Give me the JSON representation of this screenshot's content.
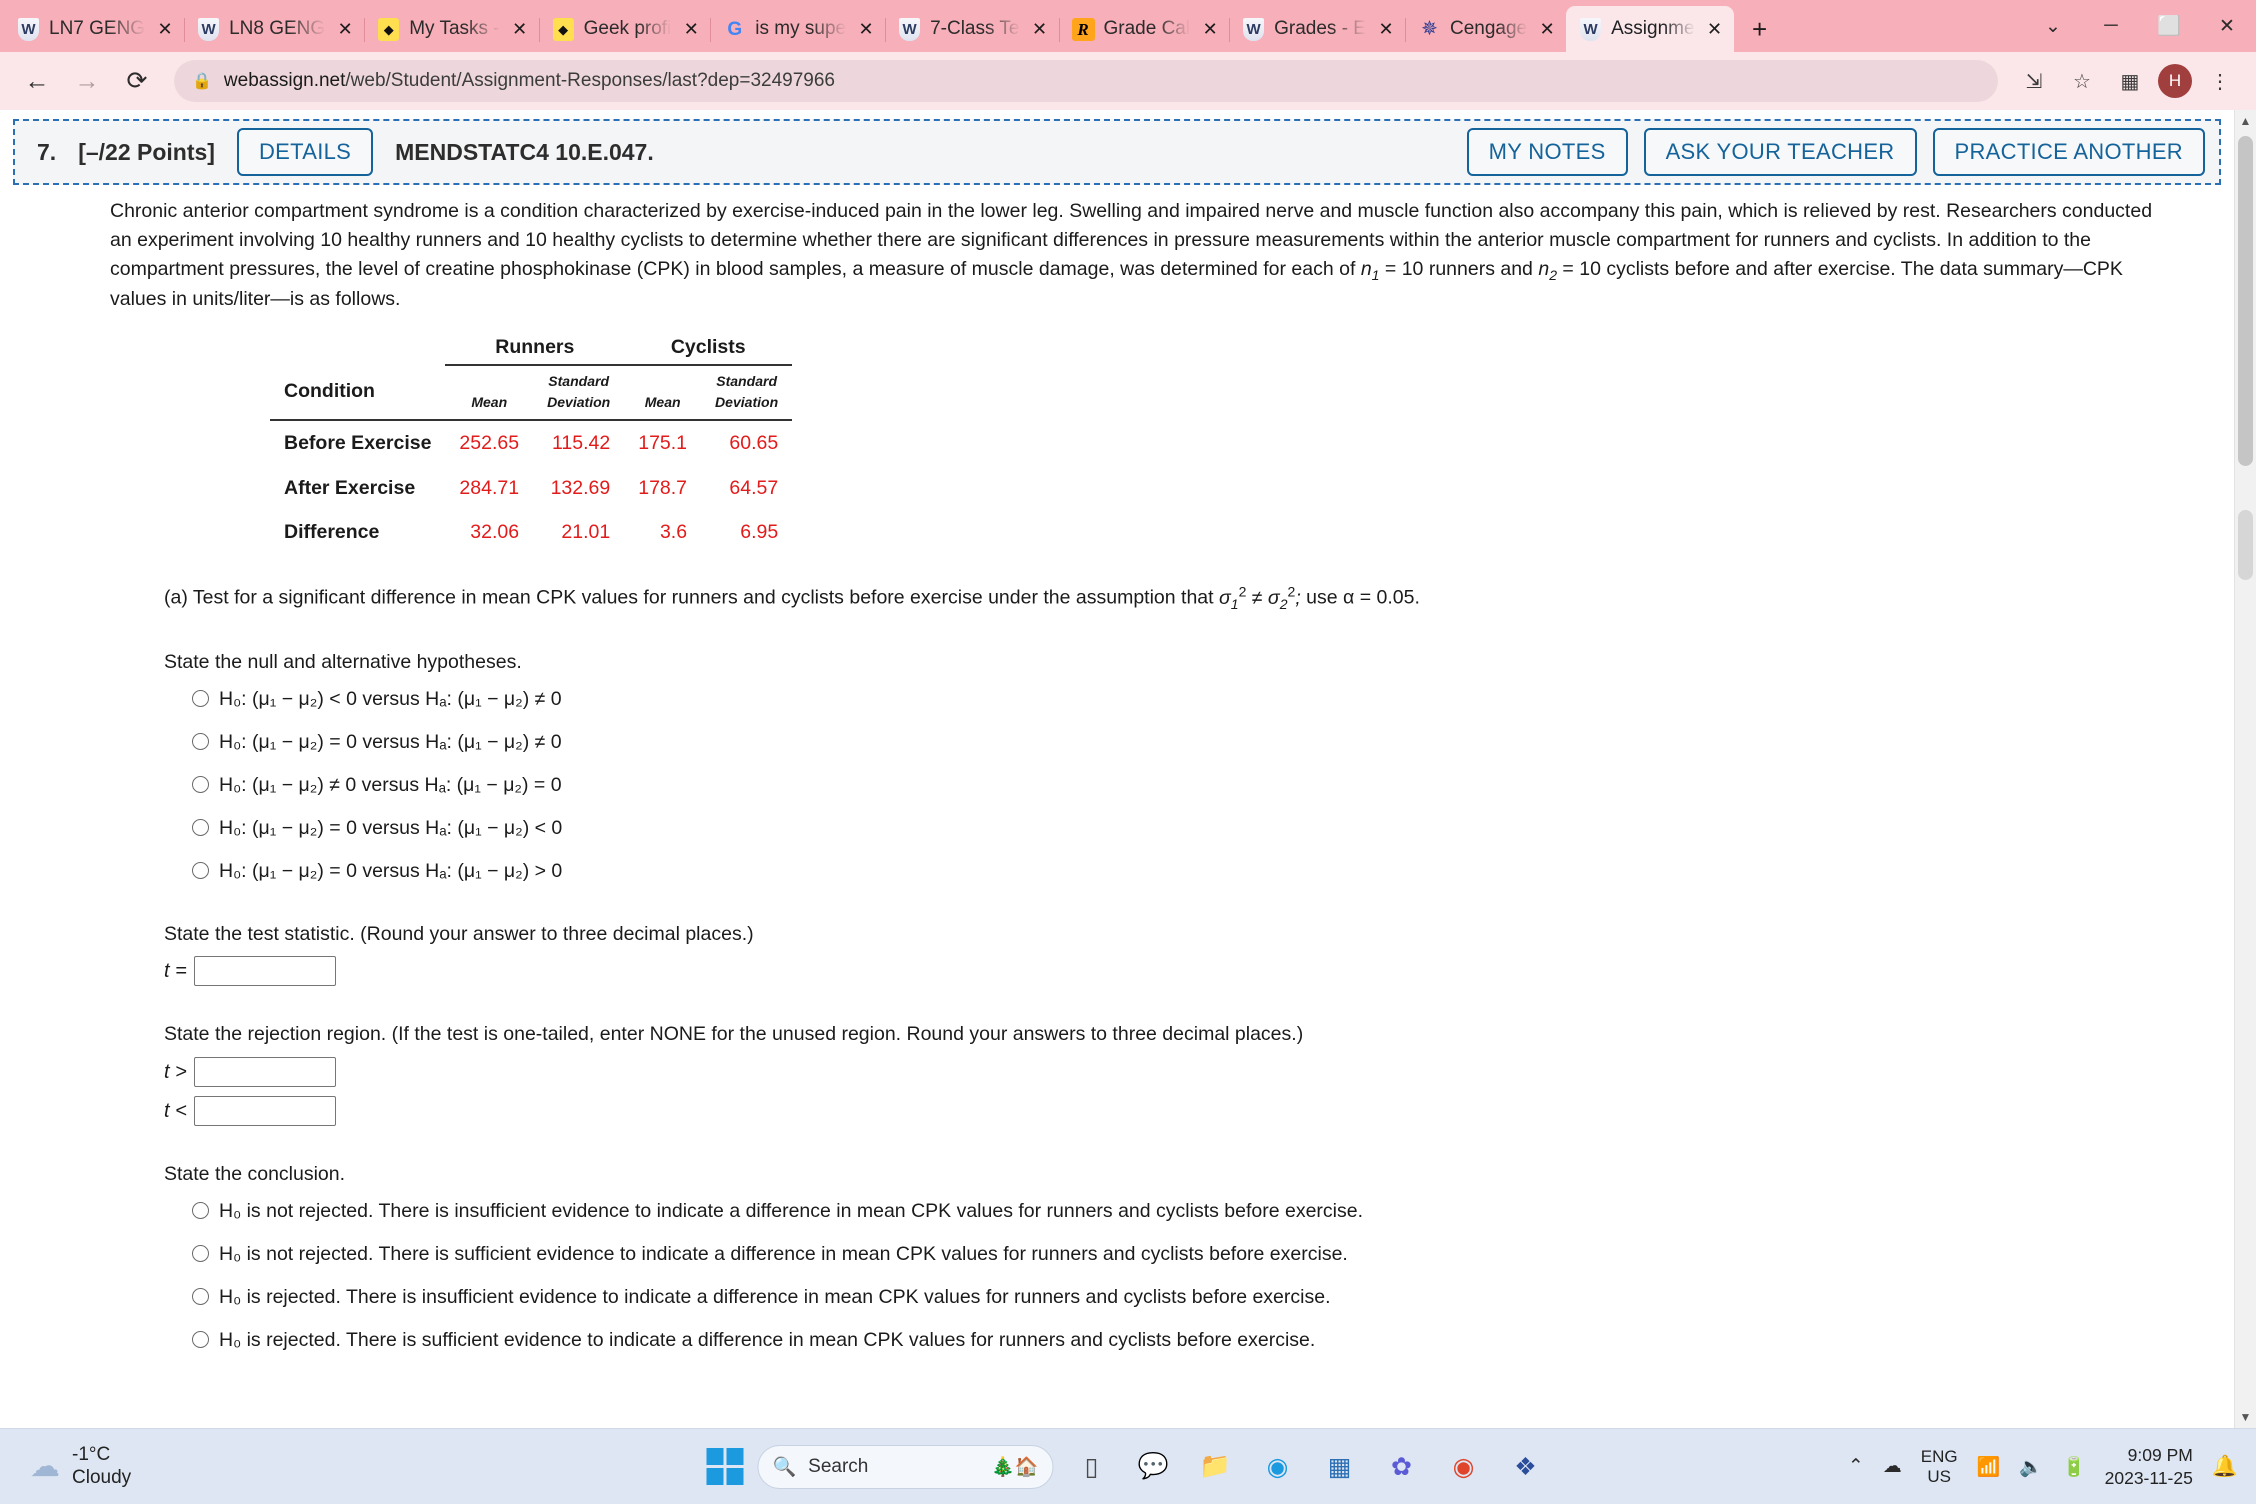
{
  "browser": {
    "tabs": [
      {
        "title": "LN7 GENG",
        "favicon": "webassign-shield-icon"
      },
      {
        "title": "LN8 GENG",
        "favicon": "webassign-shield-icon"
      },
      {
        "title": "My Tasks -",
        "favicon": "yellow-diamond-icon"
      },
      {
        "title": "Geek profi",
        "favicon": "yellow-diamond-icon"
      },
      {
        "title": "is my supe",
        "favicon": "google-icon"
      },
      {
        "title": "7-Class Te",
        "favicon": "webassign-shield-icon"
      },
      {
        "title": "Grade Cal",
        "favicon": "rstudio-icon"
      },
      {
        "title": "Grades - E",
        "favicon": "webassign-shield-icon"
      },
      {
        "title": "Cengage",
        "favicon": "cengage-icon"
      },
      {
        "title": "Assignme",
        "favicon": "webassign-shield-icon",
        "active": true
      }
    ],
    "new_tab_label": "+",
    "window_controls": {
      "collapse": "⌄",
      "minimize": "─",
      "maximize": "⬜",
      "close": "✕"
    },
    "nav": {
      "back": "←",
      "forward": "→",
      "reload": "⟳"
    },
    "omnibox": {
      "lock_icon": "lock-icon",
      "host": "webassign.net",
      "path": "/web/Student/Assignment-Responses/last?dep=32497966"
    },
    "toolbar_icons": [
      "share-icon",
      "bookmark-star-icon",
      "sidepanel-icon"
    ],
    "avatar_initial": "H",
    "menu_icon": "⋮"
  },
  "question_header": {
    "number": "7.",
    "points": "[–/22 Points]",
    "details_label": "DETAILS",
    "code": "MENDSTATC4 10.E.047.",
    "actions": [
      "MY NOTES",
      "ASK YOUR TEACHER",
      "PRACTICE ANOTHER"
    ]
  },
  "problem": {
    "paragraph_1": "Chronic anterior compartment syndrome is a condition characterized by exercise-induced pain in the lower leg. Swelling and impaired nerve and muscle function also accompany this pain, which is relieved by rest. Researchers conducted an experiment involving 10 healthy runners and 10 healthy cyclists to determine whether there are significant differences in pressure measurements within the anterior muscle compartment for runners and cyclists. In addition to the compartment pressures, the level of creatine phosphokinase (CPK) in blood samples, a measure of muscle damage, was determined for each of",
    "n1_text": "= 10",
    "mid_text": "runners and",
    "n2_text": "= 10",
    "paragraph_2_tail": "cyclists before and after exercise. The data summary—CPK values in units/liter—is as follows."
  },
  "table": {
    "group_headers": [
      "Runners",
      "Cyclists"
    ],
    "columns": [
      "Condition",
      "Mean",
      "Standard Deviation",
      "Mean",
      "Standard Deviation"
    ],
    "rows": [
      {
        "condition": "Before Exercise",
        "runners_mean": "252.65",
        "runners_sd": "115.42",
        "cyclists_mean": "175.1",
        "cyclists_sd": "60.65"
      },
      {
        "condition": "After Exercise",
        "runners_mean": "284.71",
        "runners_sd": "132.69",
        "cyclists_mean": "178.7",
        "cyclists_sd": "64.57"
      },
      {
        "condition": "Difference",
        "runners_mean": "32.06",
        "runners_sd": "21.01",
        "cyclists_mean": "3.6",
        "cyclists_sd": "6.95"
      }
    ],
    "value_color": "#e21b1b"
  },
  "part_a": {
    "label": "(a) Test for a significant difference in mean CPK values for runners and cyclists before exercise under the assumption that",
    "variance_condition": "σ₁² ≠ σ₂²;",
    "alpha_text": "use α = 0.05.",
    "hypotheses_prompt": "State the null and alternative hypotheses.",
    "hypotheses_options": [
      "H₀: (μ₁ − μ₂) < 0 versus Hₐ: (μ₁ − μ₂) ≠ 0",
      "H₀: (μ₁ − μ₂) = 0 versus Hₐ: (μ₁ − μ₂) ≠ 0",
      "H₀: (μ₁ − μ₂) ≠ 0 versus Hₐ: (μ₁ − μ₂) = 0",
      "H₀: (μ₁ − μ₂) = 0 versus Hₐ: (μ₁ − μ₂) < 0",
      "H₀: (μ₁ − μ₂) = 0 versus Hₐ: (μ₁ − μ₂) > 0"
    ],
    "test_statistic_prompt": "State the test statistic. (Round your answer to three decimal places.)",
    "test_statistic_symbol": "t =",
    "test_statistic_value": "",
    "rejection_prompt": "State the rejection region. (If the test is one-tailed, enter NONE for the unused region. Round your answers to three decimal places.)",
    "rejection_upper_symbol": "t >",
    "rejection_upper_value": "",
    "rejection_lower_symbol": "t <",
    "rejection_lower_value": "",
    "conclusion_prompt": "State the conclusion.",
    "conclusion_options": [
      "H₀ is not rejected. There is insufficient evidence to indicate a difference in mean CPK values for runners and cyclists before exercise.",
      "H₀ is not rejected. There is sufficient evidence to indicate a difference in mean CPK values for runners and cyclists before exercise.",
      "H₀ is rejected. There is insufficient evidence to indicate a difference in mean CPK values for runners and cyclists before exercise.",
      "H₀ is rejected. There is sufficient evidence to indicate a difference in mean CPK values for runners and cyclists before exercise."
    ]
  },
  "taskbar": {
    "weather": {
      "temperature": "-1°C",
      "condition": "Cloudy",
      "icon": "cloud-icon"
    },
    "start_label": "start-button",
    "search": {
      "placeholder": "Search",
      "icon": "search-icon",
      "emoji": "🎄🏠"
    },
    "apps": [
      "task-view-icon",
      "chat-icon",
      "file-explorer-icon",
      "edge-icon",
      "store-icon",
      "teams-icon",
      "chrome-icon",
      "vscode-icon"
    ],
    "tray": {
      "overflow": "⌃",
      "onedrive": "cloud-icon",
      "language": "ENG",
      "language_region": "US",
      "wifi": "wifi-icon",
      "volume": "volume-icon",
      "battery": "battery-charging-icon",
      "time": "9:09 PM",
      "date": "2023-11-25",
      "notifications": "bell-icon"
    }
  }
}
